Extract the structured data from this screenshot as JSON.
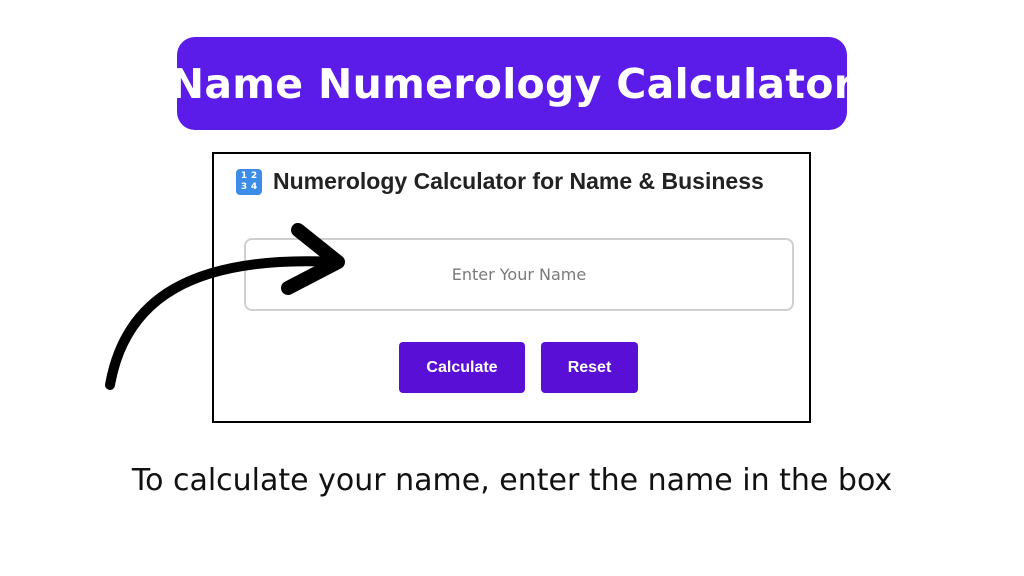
{
  "banner": {
    "title": "Name Numerology Calculator"
  },
  "calculator": {
    "icon": "input-numbers-icon",
    "icon_digits": [
      "1",
      "2",
      "3",
      "4"
    ],
    "title": "Numerology Calculator for Name & Business",
    "input": {
      "placeholder": "Enter Your Name",
      "value": ""
    },
    "buttons": {
      "calculate": "Calculate",
      "reset": "Reset"
    }
  },
  "annotation": {
    "arrow_icon": "curved-arrow-icon"
  },
  "caption": "To calculate your name, enter the name in the box",
  "colors": {
    "banner": "#5b1be8",
    "button": "#5a0fd6",
    "icon": "#3d8de8",
    "card_border": "#000000"
  }
}
